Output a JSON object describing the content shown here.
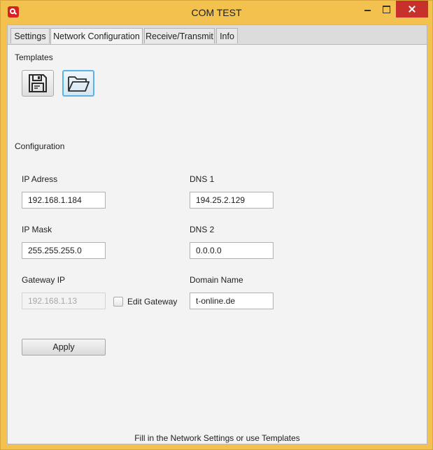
{
  "window": {
    "title": "COM TEST"
  },
  "tabs": [
    {
      "label": "Settings",
      "active": false
    },
    {
      "label": "Network Configuration",
      "active": true
    },
    {
      "label": "Receive/Transmit",
      "active": false
    },
    {
      "label": "Info",
      "active": false
    }
  ],
  "templates": {
    "heading": "Templates",
    "save_icon": "floppy-disk-icon",
    "open_icon": "folder-open-icon"
  },
  "configuration": {
    "heading": "Configuration",
    "ip_address_label": "IP Adress",
    "ip_address_value": "192.168.1.184",
    "ip_mask_label": "IP Mask",
    "ip_mask_value": "255.255.255.0",
    "gateway_label": "Gateway IP",
    "gateway_value": "192.168.1.13",
    "edit_gateway_label": "Edit Gateway",
    "edit_gateway_checked": false,
    "dns1_label": "DNS 1",
    "dns1_value": "194.25.2.129",
    "dns2_label": "DNS 2",
    "dns2_value": "0.0.0.0",
    "domain_label": "Domain Name",
    "domain_value": "t-online.de",
    "apply_label": "Apply"
  },
  "status": {
    "text": "Fill in the Network Settings or use Templates"
  },
  "colors": {
    "frame": "#f2c14e",
    "close_button": "#c7302b",
    "focus": "#5ab2e6"
  }
}
